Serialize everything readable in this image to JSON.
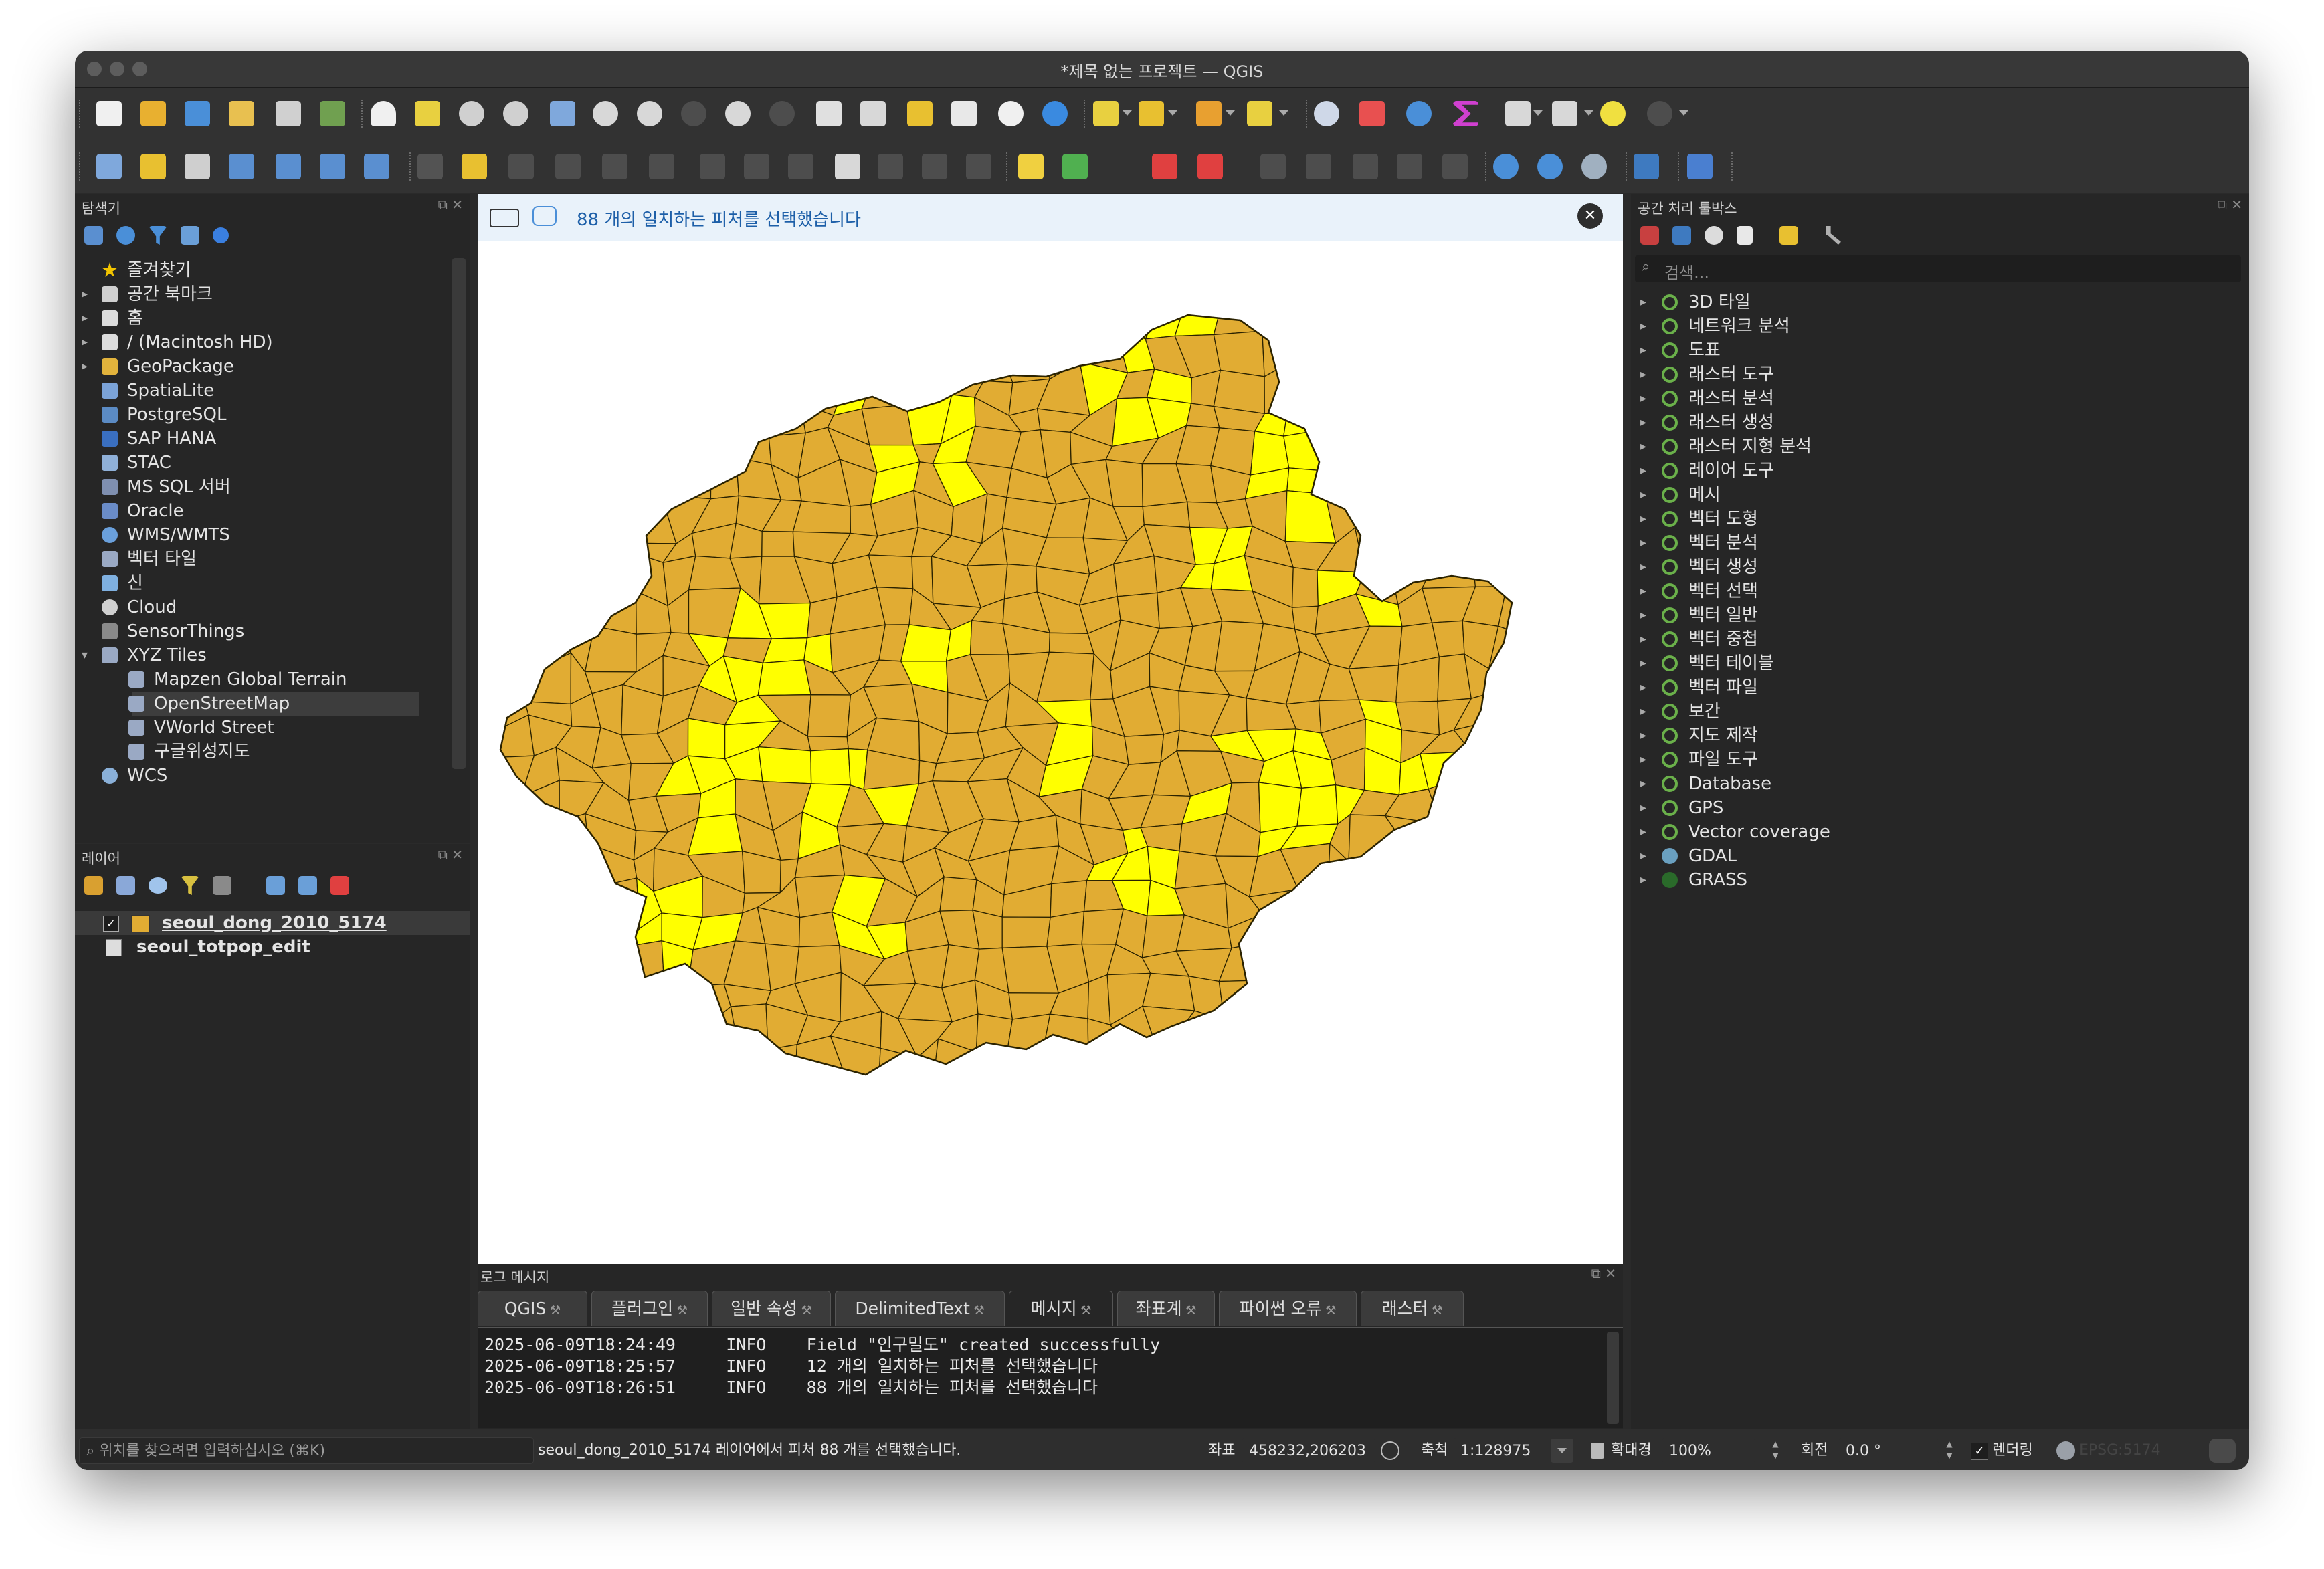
{
  "window": {
    "title": "*제목 없는 프로젝트 — QGIS"
  },
  "message_bar": {
    "text": "88 개의 일치하는 피처를 선택했습니다",
    "close_symbol": "✕"
  },
  "browser_panel": {
    "title": "탐색기",
    "items": [
      {
        "label": "즐겨찾기",
        "icon": "star-icon",
        "color": "#f2c400",
        "expand": "",
        "indent": 0,
        "selected": false
      },
      {
        "label": "공간 북마크",
        "icon": "bookmark-icon",
        "color": "#cfcfcf",
        "expand": "▸",
        "indent": 0,
        "selected": false
      },
      {
        "label": "홈",
        "icon": "home-folder-icon",
        "color": "#dcdcdc",
        "expand": "▸",
        "indent": 0,
        "selected": false
      },
      {
        "label": "/ (Macintosh HD)",
        "icon": "folder-icon",
        "color": "#dcdcdc",
        "expand": "▸",
        "indent": 0,
        "selected": false
      },
      {
        "label": "GeoPackage",
        "icon": "geopackage-icon",
        "color": "#e2b33c",
        "expand": "▸",
        "indent": 0,
        "selected": false
      },
      {
        "label": "SpatiaLite",
        "icon": "spatialite-icon",
        "color": "#7ba3d8",
        "expand": "",
        "indent": 0,
        "selected": false
      },
      {
        "label": "PostgreSQL",
        "icon": "postgresql-icon",
        "color": "#5b8bc4",
        "expand": "",
        "indent": 0,
        "selected": false
      },
      {
        "label": "SAP HANA",
        "icon": "sap-hana-icon",
        "color": "#3a6fc0",
        "expand": "",
        "indent": 0,
        "selected": false
      },
      {
        "label": "STAC",
        "icon": "stac-icon",
        "color": "#8fb0d8",
        "expand": "",
        "indent": 0,
        "selected": false
      },
      {
        "label": "MS SQL 서버",
        "icon": "mssql-icon",
        "color": "#7f8fb0",
        "expand": "",
        "indent": 0,
        "selected": false
      },
      {
        "label": "Oracle",
        "icon": "oracle-icon",
        "color": "#6a8cc8",
        "expand": "",
        "indent": 0,
        "selected": false
      },
      {
        "label": "WMS/WMTS",
        "icon": "globe-icon",
        "color": "#6aa0dc",
        "expand": "",
        "indent": 0,
        "selected": false
      },
      {
        "label": "벡터 타일",
        "icon": "vector-tile-icon",
        "color": "#9aa9c4",
        "expand": "",
        "indent": 0,
        "selected": false
      },
      {
        "label": "신",
        "icon": "scene-icon",
        "color": "#7fb0e0",
        "expand": "",
        "indent": 0,
        "selected": false
      },
      {
        "label": "Cloud",
        "icon": "cloud-icon",
        "color": "#d0d0d0",
        "expand": "",
        "indent": 0,
        "selected": false
      },
      {
        "label": "SensorThings",
        "icon": "sensorthings-icon",
        "color": "#8a8a8a",
        "expand": "",
        "indent": 0,
        "selected": false
      },
      {
        "label": "XYZ Tiles",
        "icon": "xyz-tiles-icon",
        "color": "#9aa9c4",
        "expand": "▾",
        "indent": 0,
        "selected": false
      },
      {
        "label": "Mapzen Global Terrain",
        "icon": "tile-grid-icon",
        "color": "#9aa9c4",
        "expand": "",
        "indent": 1,
        "selected": false
      },
      {
        "label": "OpenStreetMap",
        "icon": "tile-grid-icon",
        "color": "#9aa9c4",
        "expand": "",
        "indent": 1,
        "selected": true
      },
      {
        "label": "VWorld Street",
        "icon": "tile-grid-icon",
        "color": "#9aa9c4",
        "expand": "",
        "indent": 1,
        "selected": false
      },
      {
        "label": "구글위성지도",
        "icon": "tile-grid-icon",
        "color": "#9aa9c4",
        "expand": "",
        "indent": 1,
        "selected": false
      },
      {
        "label": "WCS",
        "icon": "wcs-globe-icon",
        "color": "#8ab0d8",
        "expand": "",
        "indent": 0,
        "selected": false
      }
    ]
  },
  "layers_panel": {
    "title": "레이어",
    "layers": [
      {
        "name": "seoul_dong_2010_5174",
        "checked": true,
        "swatch": "#e1ac33",
        "active": true
      },
      {
        "name": "seoul_totpop_edit",
        "checked": false,
        "swatch": "",
        "active": false
      }
    ]
  },
  "toolbox_panel": {
    "title": "공간 처리 툴박스",
    "search_placeholder": "검색...",
    "groups": [
      {
        "label": "3D 타일",
        "icon": "qgis-icon"
      },
      {
        "label": "네트워크 분석",
        "icon": "qgis-icon"
      },
      {
        "label": "도표",
        "icon": "qgis-icon"
      },
      {
        "label": "래스터 도구",
        "icon": "qgis-icon"
      },
      {
        "label": "래스터 분석",
        "icon": "qgis-icon"
      },
      {
        "label": "래스터 생성",
        "icon": "qgis-icon"
      },
      {
        "label": "래스터 지형 분석",
        "icon": "qgis-icon"
      },
      {
        "label": "레이어 도구",
        "icon": "qgis-icon"
      },
      {
        "label": "메시",
        "icon": "qgis-icon"
      },
      {
        "label": "벡터 도형",
        "icon": "qgis-icon"
      },
      {
        "label": "벡터 분석",
        "icon": "qgis-icon"
      },
      {
        "label": "벡터 생성",
        "icon": "qgis-icon"
      },
      {
        "label": "벡터 선택",
        "icon": "qgis-icon"
      },
      {
        "label": "벡터 일반",
        "icon": "qgis-icon"
      },
      {
        "label": "벡터 중첩",
        "icon": "qgis-icon"
      },
      {
        "label": "벡터 테이블",
        "icon": "qgis-icon"
      },
      {
        "label": "벡터 파일",
        "icon": "qgis-icon"
      },
      {
        "label": "보간",
        "icon": "qgis-icon"
      },
      {
        "label": "지도 제작",
        "icon": "qgis-icon"
      },
      {
        "label": "파일 도구",
        "icon": "qgis-icon"
      },
      {
        "label": "Database",
        "icon": "qgis-icon"
      },
      {
        "label": "GPS",
        "icon": "qgis-icon"
      },
      {
        "label": "Vector coverage",
        "icon": "qgis-icon"
      },
      {
        "label": "GDAL",
        "icon": "gdal-icon"
      },
      {
        "label": "GRASS",
        "icon": "grass-icon"
      }
    ]
  },
  "log_panel": {
    "title": "로그 메시지",
    "tabs": [
      {
        "label": "QGIS",
        "active": false
      },
      {
        "label": "플러그인",
        "active": false
      },
      {
        "label": "일반 속성",
        "active": false
      },
      {
        "label": "DelimitedText",
        "active": false
      },
      {
        "label": "메시지",
        "active": true
      },
      {
        "label": "좌표계",
        "active": false
      },
      {
        "label": "파이썬 오류",
        "active": false
      },
      {
        "label": "래스터",
        "active": false
      }
    ],
    "lines": [
      "2025-06-09T18:24:49     INFO    Field \"인구밀도\" created successfully",
      "2025-06-09T18:25:57     INFO    12 개의 일치하는 피처를 선택했습니다",
      "2025-06-09T18:26:51     INFO    88 개의 일치하는 피처를 선택했습니다"
    ]
  },
  "statusbar": {
    "locator_placeholder": "위치를 찾으려면 입력하십시오 (⌘K)",
    "message": "seoul_dong_2010_5174 레이어에서 피처 88 개를 선택했습니다.",
    "coord_label": "좌표",
    "coord_value": "458232,206203",
    "scale_label": "축척",
    "scale_value": "1:128975",
    "magnifier_label": "확대경",
    "magnifier_value": "100%",
    "rotation_label": "회전",
    "rotation_value": "0.0 °",
    "render_label": "렌더링",
    "render_checked": true,
    "crs": "EPSG:5174"
  },
  "map": {
    "fill_color": "#e1ac33",
    "selected_color": "#ffff00",
    "outline_color": "#2a2200",
    "selected_feature_count": 88
  },
  "colors": {
    "accent_blue": "#2f74c4",
    "panel_bg": "#262626",
    "toolbar_bg": "#323232"
  }
}
